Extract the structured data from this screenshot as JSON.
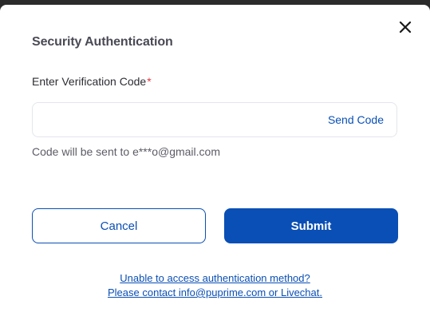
{
  "dialog": {
    "title": "Security Authentication",
    "close_icon": "close-icon"
  },
  "verification": {
    "label": "Enter Verification Code",
    "required_marker": "*",
    "input_value": "",
    "input_placeholder": "",
    "send_code_label": "Send Code",
    "hint": "Code will be sent to e***o@gmail.com"
  },
  "actions": {
    "cancel_label": "Cancel",
    "submit_label": "Submit"
  },
  "help": {
    "line1": "Unable to access authentication method?",
    "line2": "Please contact info@puprime.com or Livechat."
  },
  "colors": {
    "brand": "#0a4fb5",
    "required": "#e0383e",
    "border": "#e4e6ec"
  }
}
